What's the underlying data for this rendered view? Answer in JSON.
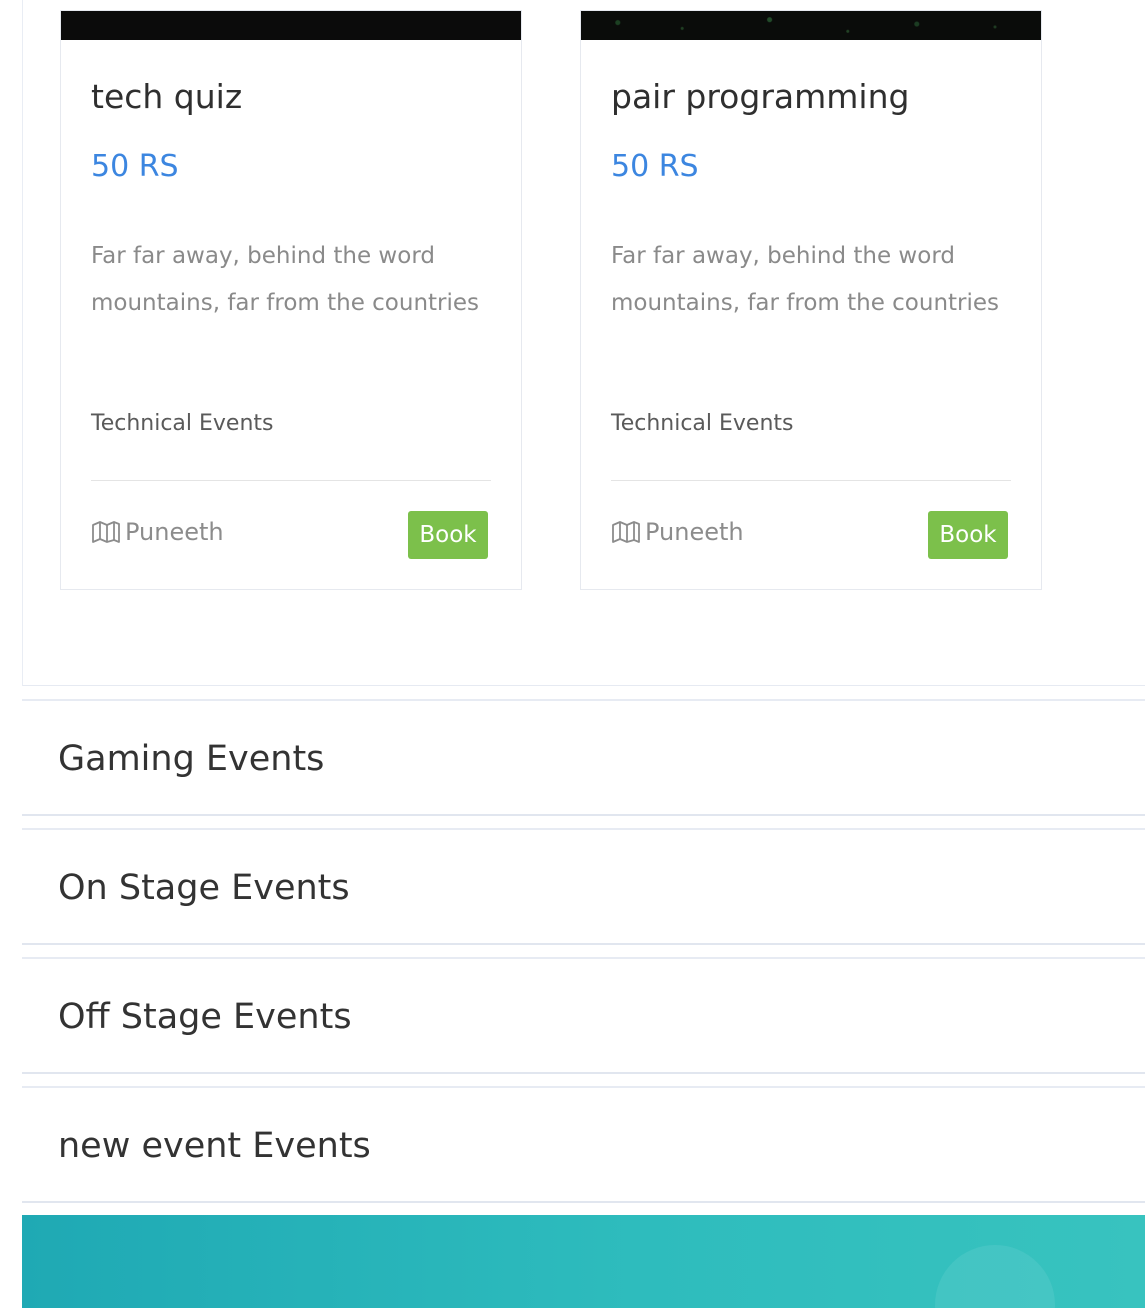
{
  "events": [
    {
      "title": "tech quiz",
      "price": "50 RS",
      "description": "Far far away, behind the word mountains, far from the countries",
      "category": "Technical Events",
      "host": "Puneeth",
      "book_label": "Book"
    },
    {
      "title": "pair programming",
      "price": "50 RS",
      "description": "Far far away, behind the word mountains, far from the countries",
      "category": "Technical Events",
      "host": "Puneeth",
      "book_label": "Book"
    }
  ],
  "categories": [
    {
      "label": "Gaming Events"
    },
    {
      "label": "On Stage Events"
    },
    {
      "label": "Off Stage Events"
    },
    {
      "label": "new event Events"
    }
  ],
  "icons": {
    "host": "map-icon"
  },
  "colors": {
    "price": "#3c86e0",
    "book_button": "#7cc04b",
    "footer_start": "#1fa9b4",
    "footer_end": "#38c3bf"
  }
}
